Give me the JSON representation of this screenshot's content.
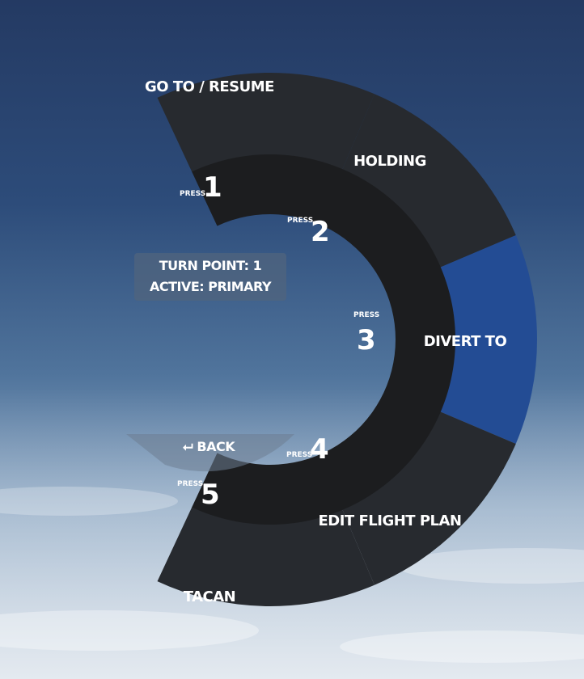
{
  "wheel": {
    "options": [
      {
        "id": "goto",
        "label": "GO TO / RESUME",
        "press_word": "PRESS",
        "press_key": "1",
        "active": false
      },
      {
        "id": "holding",
        "label": "HOLDING",
        "press_word": "PRESS",
        "press_key": "2",
        "active": false
      },
      {
        "id": "divert",
        "label": "DIVERT TO",
        "press_word": "PRESS",
        "press_key": "3",
        "active": true
      },
      {
        "id": "edit",
        "label": "EDIT FLIGHT PLAN",
        "press_word": "PRESS",
        "press_key": "4",
        "active": false
      },
      {
        "id": "tacan",
        "label": "TACAN",
        "press_word": "PRESS",
        "press_key": "5",
        "active": false
      }
    ],
    "back_label": "BACK",
    "back_icon": "return-arrow-icon"
  },
  "info": {
    "line1": "TURN POINT: 1",
    "line2": "ACTIVE: PRIMARY"
  },
  "colors": {
    "segment_dark": "#272a2f",
    "segment_highlight": "#234c94",
    "inner_ring": "#1c1d1f",
    "info_bg": "#50647d"
  }
}
